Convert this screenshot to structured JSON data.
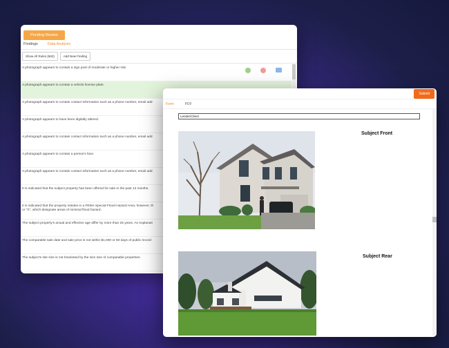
{
  "review": {
    "badge": "Pending Review",
    "tabs": [
      {
        "label": "Findings"
      },
      {
        "label": "Data Analysis"
      }
    ],
    "toolbar": {
      "show_all": "Show All Rules (663)",
      "add_new": "Add New Finding"
    },
    "findings": [
      "A photograph appears to contain a sign post of moderate or higher risk.",
      "A photograph appears to contain a vehicle license plate.",
      "A photograph appears to contain contact information such as a phone number, email add",
      "A photograph appears to have been digitally altered.",
      "A photograph appears to contain contact information such as a phone number, email add",
      "A photograph appears to contain a person's face.",
      "A photograph appears to contain contact information such as a phone number, email add",
      "It is indicated that the subject property has been offered for sale in the past 12 months.",
      "It is indicated that the property resides in a FEMA Special Flood Hazard Area, however, th",
      "or \"X\", which designate areas of minimal flood hazard.",
      "The subject property's actual and effective age differ by more than 25 years. An explanati",
      "The comparable sale date and sale price is not within $1,000 or 60 days of public record",
      "The subject's site size is not bracketed by the size size of comparable properties."
    ]
  },
  "document": {
    "submit": "Submit",
    "tabs": [
      {
        "label": "Form"
      },
      {
        "label": "PDF"
      }
    ],
    "lender_label": "Lender/Client",
    "photos": [
      {
        "caption": "Subject Front"
      },
      {
        "caption": "Subject Rear"
      }
    ]
  },
  "colors": {
    "accent_orange": "#f16a1a",
    "badge_orange": "#f5a748",
    "highlight_green": "#e3f4dc"
  }
}
